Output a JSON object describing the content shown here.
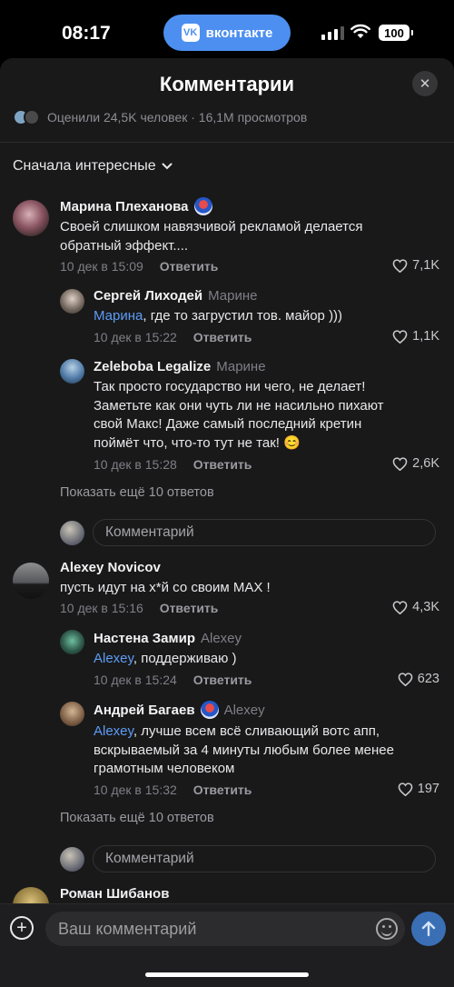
{
  "status_bar": {
    "time": "08:17",
    "app_pill": "вконтакте",
    "battery": "100"
  },
  "sheet": {
    "title": "Комментарии",
    "stats": "Оценили 24,5K человек · 16,1M просмотров",
    "sort": "Сначала интересные"
  },
  "comments": [
    {
      "author": "Марина Плеханова",
      "text_lines": [
        "Своей слишком навязчивой рекламой делается",
        "обратный эффект...."
      ],
      "time": "10 дек в 15:09",
      "reply_label": "Ответить",
      "likes": "7,1K",
      "replies": [
        {
          "author": "Сергей Лиходей",
          "to": "Марине",
          "mention": "Марина",
          "text": ", где то загрустил тов. майор )))",
          "time": "10 дек в 15:22",
          "reply_label": "Ответить",
          "likes": "1,1K"
        },
        {
          "author": "Zeleboba Legalize",
          "to": "Марине",
          "text_lines": [
            "Так просто государство ни чего, не делает!",
            "Заметьте как они чуть ли не насильно пихают",
            "свой Макс!  Даже самый последний кретин",
            "поймёт что, что-то тут не так! 😊"
          ],
          "time": "10 дек в 15:28",
          "reply_label": "Ответить",
          "likes": "2,6K"
        }
      ],
      "show_more": "Показать ещё 10 ответов",
      "comment_placeholder": "Комментарий"
    },
    {
      "author": "Alexey Novicov",
      "text": "пусть идут на х*й со своим MAX !",
      "time": "10 дек в 15:16",
      "reply_label": "Ответить",
      "likes": "4,3K",
      "replies": [
        {
          "author": "Настена Замир",
          "to": "Alexey",
          "mention": "Alexey",
          "text": ", поддерживаю )",
          "time": "10 дек в 15:24",
          "reply_label": "Ответить",
          "likes": "623"
        },
        {
          "author": "Андрей Багаев",
          "to": "Alexey",
          "mention": "Alexey",
          "text_first": ", лучше всем всё сливающий вотс апп,",
          "text_lines": [
            "вскрываемый за 4 минуты любым более менее",
            "грамотным человеком"
          ],
          "time": "10 дек в 15:32",
          "reply_label": "Ответить",
          "likes": "197"
        }
      ],
      "show_more": "Показать ещё 10 ответов",
      "comment_placeholder": "Комментарий"
    },
    {
      "author": "Роман Шибанов"
    }
  ],
  "bottom_bar": {
    "input_placeholder": "Ваш комментарий"
  },
  "colors": {
    "accent": "#4d8ff0",
    "mention": "#5d9cf5",
    "sheet_bg": "#19191a"
  }
}
